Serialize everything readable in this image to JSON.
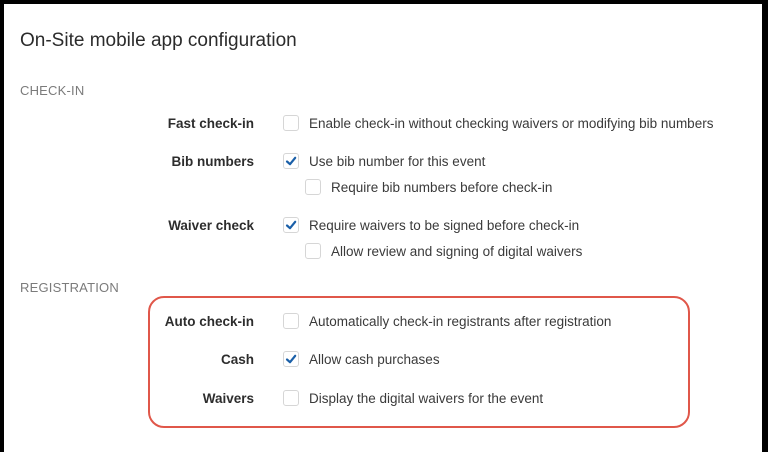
{
  "page": {
    "title": "On-Site mobile app configuration"
  },
  "sections": {
    "checkin": {
      "heading": "CHECK-IN",
      "fast_checkin": {
        "label": "Fast check-in",
        "option": "Enable check-in without checking waivers or modifying bib numbers",
        "checked": false
      },
      "bib_numbers": {
        "label": "Bib numbers",
        "option": "Use bib number for this event",
        "checked": true,
        "sub_option": "Require bib numbers before check-in",
        "sub_checked": false
      },
      "waiver_check": {
        "label": "Waiver check",
        "option": "Require waivers to be signed before check-in",
        "checked": true,
        "sub_option": "Allow review and signing of digital waivers",
        "sub_checked": false
      }
    },
    "registration": {
      "heading": "REGISTRATION",
      "auto_checkin": {
        "label": "Auto check-in",
        "option": "Automatically check-in registrants after registration",
        "checked": false
      },
      "cash": {
        "label": "Cash",
        "option": "Allow cash purchases",
        "checked": true
      },
      "waivers": {
        "label": "Waivers",
        "option": "Display the digital waivers for the event",
        "checked": false
      }
    }
  },
  "colors": {
    "checkmark": "#1a5fa8",
    "highlight_border": "#e0574a"
  }
}
